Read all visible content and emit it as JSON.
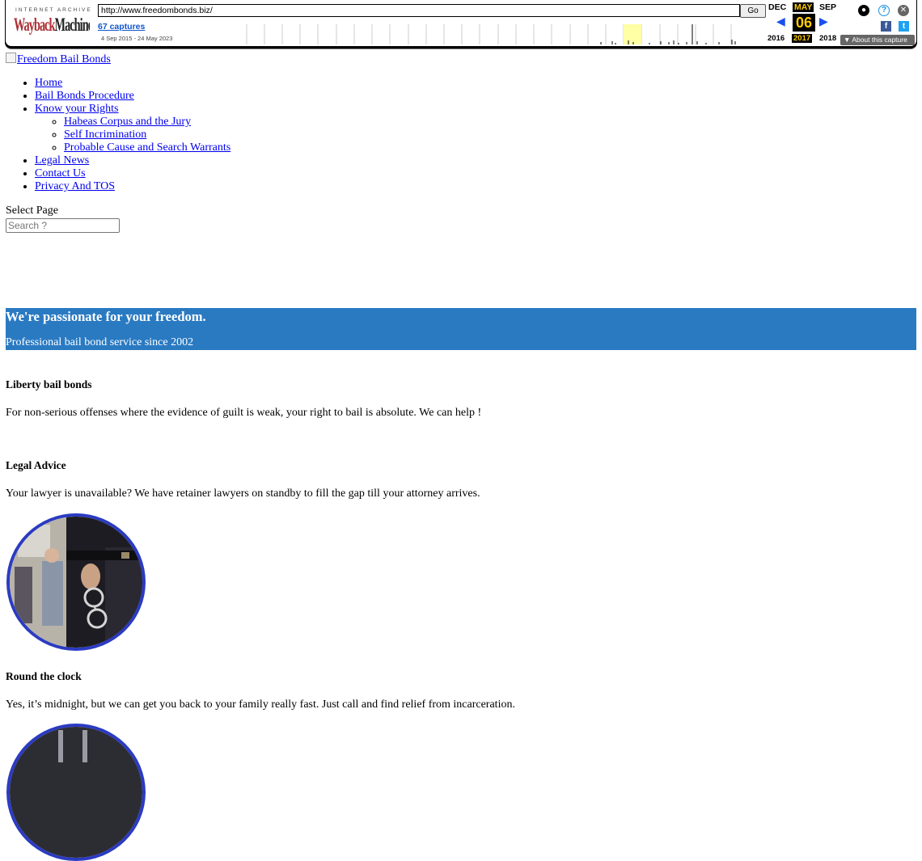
{
  "wayback": {
    "ia_label": "INTERNET ARCHIVE",
    "logo_part1": "Wayback",
    "logo_part2": "Machine",
    "url": "http://www.freedombonds.biz/",
    "go_label": "Go",
    "captures_link": "67 captures",
    "date_range": "4 Sep 2015 - 24 May 2023",
    "prev_month": "DEC",
    "current_month": "MAY",
    "next_month": "SEP",
    "current_day": "06",
    "prev_year": "2016",
    "current_year": "2017",
    "next_year": "2018",
    "about_label": "About this capture"
  },
  "site": {
    "logo_alt": "Freedom Bail Bonds",
    "menu": {
      "home": "Home",
      "procedure": "Bail Bonds Procedure",
      "rights": "Know your Rights",
      "habeas": "Habeas Corpus and the Jury",
      "self_incrimination": "Self Incrimination",
      "probable_cause": "Probable Cause and Search Warrants",
      "legal_news": "Legal News",
      "contact": "Contact Us",
      "privacy": "Privacy And TOS"
    },
    "select_page": "Select Page",
    "search_placeholder": "Search ?"
  },
  "hero": {
    "heading": "We're passionate for your freedom.",
    "subheading": "Professional bail bond service since 2002",
    "bg_color": "#2a7ac2"
  },
  "features": [
    {
      "title": "Liberty bail bonds",
      "text": "For non-serious offenses where the evidence of guilt is weak, your right to bail is absolute. We can help !"
    },
    {
      "title": "Legal Advice",
      "text": "Your lawyer is unavailable? We have retainer lawyers on standby to fill the gap till your attorney arrives."
    },
    {
      "title": "Round the clock",
      "text": "Yes, it’s midnight, but we can get you back to your family really fast. Just call and find relief from incarceration."
    }
  ]
}
